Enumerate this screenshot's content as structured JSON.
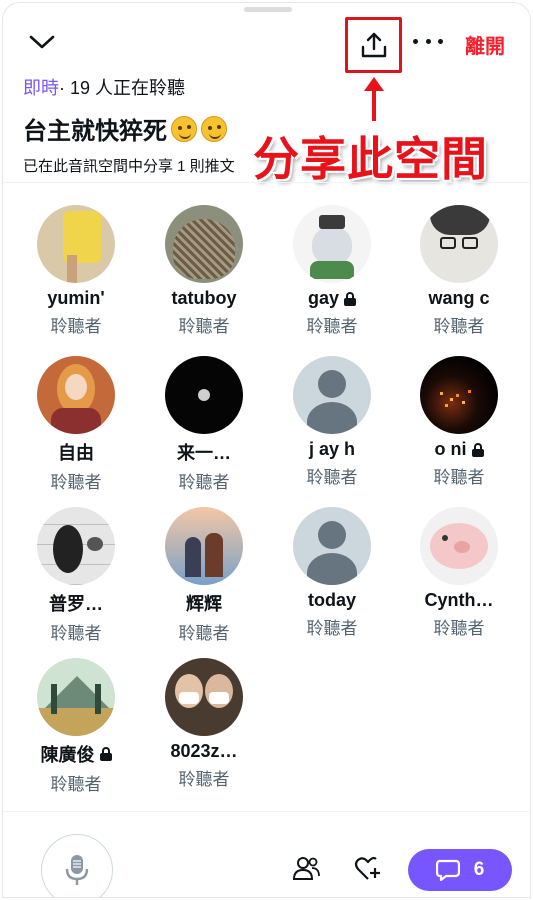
{
  "header": {
    "leave_label": "離開"
  },
  "space": {
    "live_label": "即時",
    "listening_text": "· 19 人正在聆聽",
    "title": "台主就快猝死",
    "shared_text": "已在此音訊空間中分享 1 則推文"
  },
  "annotation": {
    "text": "分享此空間",
    "color": "#e8121b"
  },
  "listeners": [
    {
      "name": "yumin'",
      "role": "聆聽者",
      "locked": false,
      "avatar": "photo-yellow-skirt"
    },
    {
      "name": "tatuboy",
      "role": "聆聽者",
      "locked": false,
      "avatar": "photo-hedgehog"
    },
    {
      "name": "gay",
      "role": "聆聽者",
      "locked": true,
      "avatar": "cartoon-cat"
    },
    {
      "name": "wang c",
      "role": "聆聽者",
      "locked": false,
      "avatar": "sketch-glasses"
    },
    {
      "name": "自由",
      "role": "聆聽者",
      "locked": false,
      "avatar": "illustration-girl"
    },
    {
      "name": "来一…",
      "role": "聆聽者",
      "locked": false,
      "avatar": "photo-moon"
    },
    {
      "name": "j ay h",
      "role": "聆聽者",
      "locked": false,
      "avatar": "default-avatar"
    },
    {
      "name": "o ni",
      "role": "聆聽者",
      "locked": true,
      "avatar": "photo-night-lights"
    },
    {
      "name": "普罗…",
      "role": "聆聽者",
      "locked": false,
      "avatar": "photo-penguin"
    },
    {
      "name": "辉辉",
      "role": "聆聽者",
      "locked": false,
      "avatar": "illustration-couple"
    },
    {
      "name": "today",
      "role": "聆聽者",
      "locked": false,
      "avatar": "default-avatar"
    },
    {
      "name": "Cynth…",
      "role": "聆聽者",
      "locked": false,
      "avatar": "cartoon-pig"
    },
    {
      "name": "陳廣俊",
      "role": "聆聽者",
      "locked": true,
      "avatar": "illustration-mountains"
    },
    {
      "name": "8023z…",
      "role": "聆聽者",
      "locked": false,
      "avatar": "photo-couple-masks"
    }
  ],
  "footer": {
    "reply_count": "6"
  },
  "colors": {
    "accent": "#7856ff",
    "leave": "#f4212e",
    "secondary_text": "#536471",
    "annotation_box": "#d9161c"
  }
}
